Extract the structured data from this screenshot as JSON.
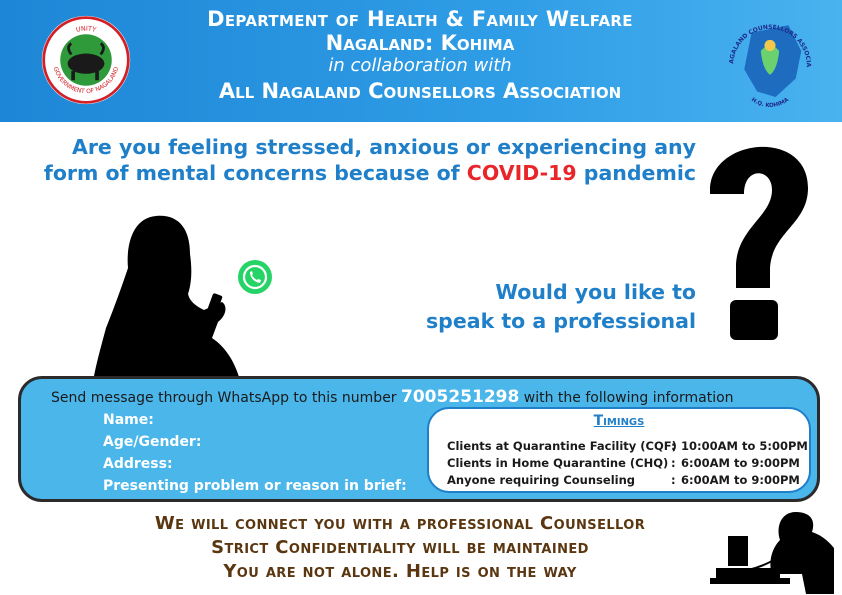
{
  "header": {
    "line1": "Department of Health & Family Welfare",
    "line2": "Nagaland: Kohima",
    "line3": "in collaboration with",
    "line4": "All Nagaland Counsellors Association"
  },
  "seal": {
    "top_text": "UNITY",
    "bottom_text": "GOVERNMENT OF NAGALAND"
  },
  "assoc_logo": {
    "ring_text": "ALL NAGALAND COUNSELLORS ASSOCIATION",
    "bottom_text": "H.Q. KOHIMA"
  },
  "question": {
    "line1": "Are you feeling stressed, anxious or experiencing any",
    "line2_pre": "form of mental concerns because of ",
    "line2_highlight": "COVID-19",
    "line2_post": " pandemic",
    "q2_line1": "Would you like to",
    "q2_line2": "speak to a professional"
  },
  "panel": {
    "send_pre": "Send message through WhatsApp to this number ",
    "phone": "7005251298",
    "send_post": " with the following information",
    "fields": [
      "Name:",
      "Age/Gender:",
      "Address:",
      "Presenting problem or reason in brief:"
    ]
  },
  "timings": {
    "title": "Timings",
    "rows": [
      {
        "label": "Clients at Quarantine Facility (CQF)",
        "time": "10:00AM to 5:00PM"
      },
      {
        "label": "Clients in Home Quarantine (CHQ)",
        "time": "6:00AM to 9:00PM"
      },
      {
        "label": "Anyone requiring Counseling",
        "time": "6:00AM to 9:00PM"
      }
    ]
  },
  "footer": {
    "line1": "We will connect you with a professional Counsellor",
    "line2": "Strict Confidentiality will be maintained",
    "line3": "You are not alone. Help is on the way"
  },
  "colors": {
    "header_blue": "#2f9de6",
    "accent_blue": "#1f7fc8",
    "covid_red": "#e8262a",
    "panel_blue": "#4ab6ea",
    "footer_brown": "#5a3710",
    "whatsapp_green": "#25d366"
  },
  "icons": [
    "nagaland-seal-icon",
    "counsellors-association-logo-icon",
    "woman-with-phone-silhouette-icon",
    "whatsapp-icon",
    "question-mark-icon",
    "telephone-operator-silhouette-icon"
  ]
}
